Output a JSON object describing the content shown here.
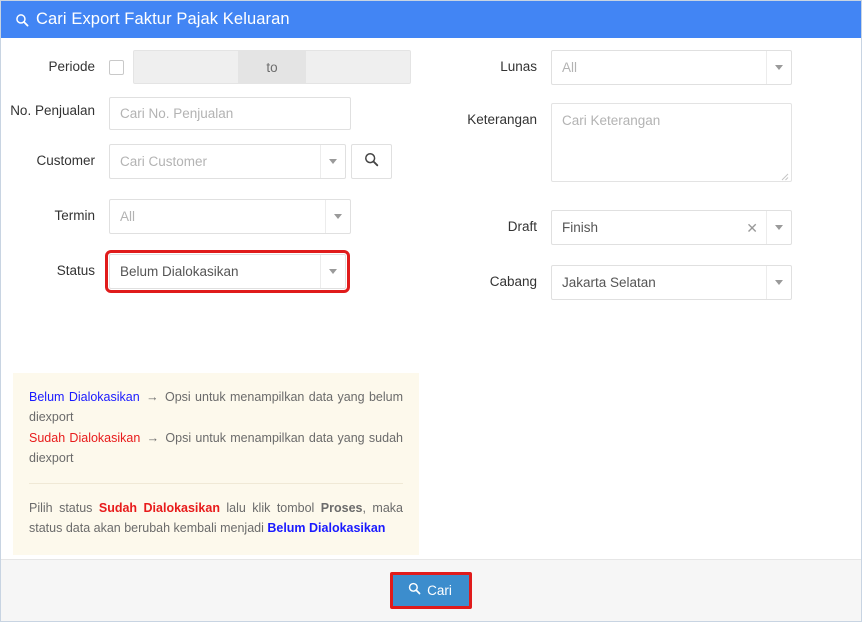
{
  "header": {
    "icon": "search-icon",
    "title": "Cari Export Faktur Pajak Keluaran"
  },
  "form": {
    "left": {
      "periode": {
        "label": "Periode",
        "checkbox_checked": false,
        "separator_text": "to",
        "start_value": "",
        "end_value": "",
        "disabled": true
      },
      "no_penjualan": {
        "label": "No. Penjualan",
        "placeholder": "Cari No. Penjualan",
        "value": ""
      },
      "customer": {
        "label": "Customer",
        "placeholder": "Cari Customer",
        "value": "",
        "search_button_icon": "search-icon"
      },
      "termin": {
        "label": "Termin",
        "value": "All"
      },
      "status": {
        "label": "Status",
        "value": "Belum Dialokasikan",
        "highlighted": true,
        "highlight_color": "#e01b1b"
      }
    },
    "right": {
      "lunas": {
        "label": "Lunas",
        "value": "All"
      },
      "keterangan": {
        "label": "Keterangan",
        "placeholder": "Cari Keterangan",
        "value": ""
      },
      "draft": {
        "label": "Draft",
        "value": "Finish",
        "clear_icon": "close-x-icon"
      },
      "cabang": {
        "label": "Cabang",
        "value": "Jakarta Selatan"
      }
    }
  },
  "info_box": {
    "line1": {
      "term": "Belum Dialokasikan",
      "arrow": "→",
      "text": "Opsi untuk menampilkan data yang belum diexport"
    },
    "line2": {
      "term": "Sudah Dialokasikan",
      "arrow": "→",
      "text": "Opsi untuk menampilkan data yang sudah diexport"
    },
    "note": {
      "part1": "Pilih status ",
      "term_red": "Sudah Dialokasikan",
      "part2": " lalu klik tombol ",
      "term_bold": "Proses",
      "part3": ", maka status data akan berubah kembali menjadi ",
      "term_blue": "Belum Dialokasikan"
    }
  },
  "footer": {
    "search_button": {
      "label": "Cari",
      "icon": "search-icon",
      "background": "#3c8dcd",
      "highlight_border": "#e01b1b"
    }
  },
  "colors": {
    "header_blue": "#4285f4",
    "info_box_bg": "#fdf9ec",
    "footer_bg": "#f6f6f6",
    "blue_text": "#1a1aff",
    "red_text": "#e81b1b"
  }
}
